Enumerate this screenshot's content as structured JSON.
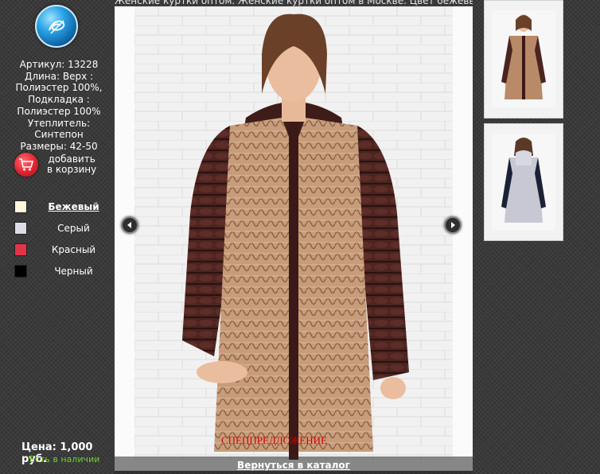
{
  "product": {
    "caption": "Женские куртки оптом. Женские куртки оптом в Москве. Цвет бежевый",
    "specs": [
      "Артикул: 13228",
      "Длина: Верх :",
      "Полиэстер 100%,",
      "Подкладка :",
      "Полиэстер 100%",
      "Утеплитель:",
      "Синтепон",
      "Размеры: 42-50"
    ],
    "cart_label_line1": "добавить",
    "cart_label_line2": "в корзину",
    "price": "Цена: 1,000 руб.",
    "stock": "Есть в наличии",
    "special": "спецпредложение",
    "back_link": "Вернуться в каталог"
  },
  "colors": [
    {
      "name": "Бежевый",
      "hex": "#fdf7dc",
      "active": true
    },
    {
      "name": "Серый",
      "hex": "#dcdce6",
      "active": false
    },
    {
      "name": "Красный",
      "hex": "#e23448",
      "active": false
    },
    {
      "name": "Черный",
      "hex": "#000000",
      "active": false
    }
  ],
  "icons": {
    "logo": "logo-icon",
    "cart": "cart-icon",
    "prev": "arrow-left-icon",
    "next": "arrow-right-icon"
  },
  "palette": {
    "background": "#3a3a3a",
    "special_text": "#d00000",
    "stock_text": "#6fcf2a",
    "jacket_sleeve": "#4a2320",
    "jacket_body": "#b98a6a"
  }
}
